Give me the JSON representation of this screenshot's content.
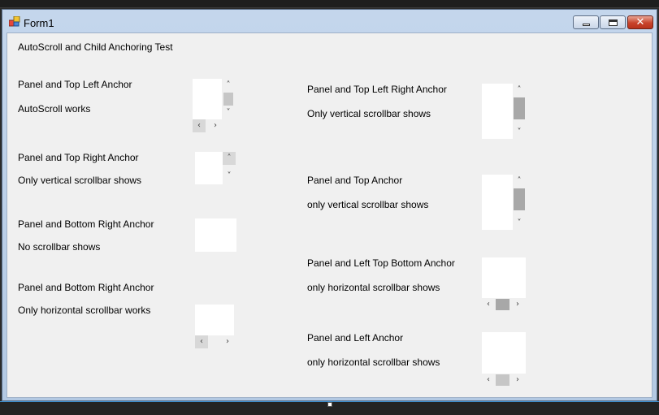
{
  "window": {
    "title": "Form1"
  },
  "heading": "AutoScroll and Child Anchoring Test",
  "sections": [
    {
      "title": "Panel and Top Left Anchor",
      "note": "AutoScroll works"
    },
    {
      "title": "Panel and Top Right Anchor",
      "note": "Only vertical scrollbar shows"
    },
    {
      "title": "Panel and Bottom Right Anchor",
      "note": "No scrollbar shows"
    },
    {
      "title": "Panel and Bottom Right Anchor",
      "note": "Only horizontal scrollbar works"
    },
    {
      "title": "Panel and Top Left Right Anchor",
      "note": "Only vertical scrollbar shows"
    },
    {
      "title": "Panel and Top Anchor",
      "note": "only vertical scrollbar shows"
    },
    {
      "title": "Panel and Left Top Bottom Anchor",
      "note": "only horizontal scrollbar shows"
    },
    {
      "title": "Panel and Left Anchor",
      "note": "only horizontal scrollbar shows"
    }
  ],
  "glyphs": {
    "up": "˄",
    "down": "˅",
    "left": "‹",
    "right": "›",
    "close": "✕"
  },
  "icons": [
    "app-icon",
    "minimize-icon",
    "maximize-icon",
    "close-icon",
    "scroll-up-arrow-icon",
    "scroll-down-arrow-icon",
    "scroll-left-arrow-icon",
    "scroll-right-arrow-icon"
  ]
}
